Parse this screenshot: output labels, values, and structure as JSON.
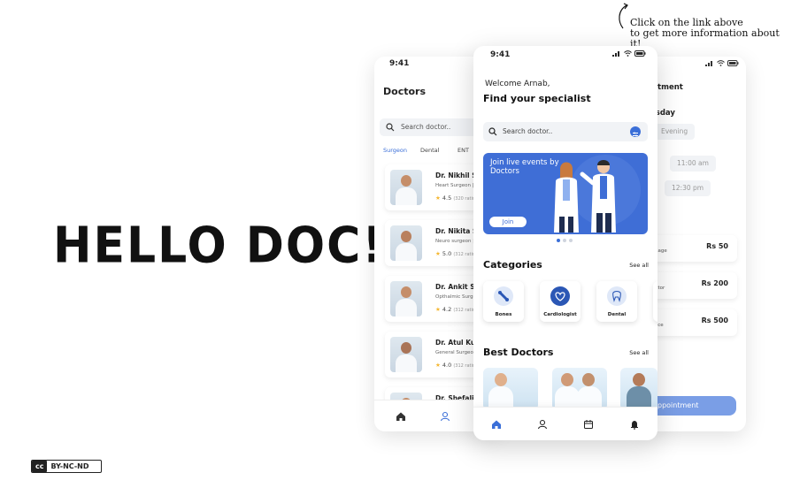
{
  "poster": {
    "title": "HELLO DOC!",
    "note_line1": "Click on the link above",
    "note_line2": "to get more information about it!",
    "license": "BY-NC-ND",
    "cc": "cc"
  },
  "phone_left": {
    "time": "9:41",
    "title": "Doctors",
    "search_placeholder": "Search doctor..",
    "tabs": [
      "Surgeon",
      "Dental",
      "ENT"
    ],
    "doctors": [
      {
        "name": "Dr. Nikhil Sh",
        "spec": "Heart Surgeon | N",
        "rating": "4.5",
        "count": "(320 ratin"
      },
      {
        "name": "Dr. Nikita Sh",
        "spec": "Neuro surgeon | ",
        "rating": "5.0",
        "count": "(312 ratin"
      },
      {
        "name": "Dr. Ankit Sin",
        "spec": "Opthalmic Surge",
        "rating": "4.2",
        "count": "(312 ratin"
      },
      {
        "name": "Dr. Atul Kull",
        "spec": "General Surgeon",
        "rating": "4.0",
        "count": "(312 ratin"
      },
      {
        "name": "Dr. Shefali S",
        "spec": "",
        "rating": "",
        "count": ""
      }
    ]
  },
  "phone_center": {
    "time": "9:41",
    "welcome": "Welcome Arnab,",
    "heading": "Find your specialist",
    "search_placeholder": "Search doctor..",
    "banner_text": "Join live events by Doctors",
    "join_label": "Join",
    "categories_title": "Categories",
    "see_all": "See all",
    "categories": [
      "Bones",
      "Cardiologist",
      "Dental"
    ],
    "best_title": "Best Doctors"
  },
  "phone_right": {
    "title": "ntment",
    "day": "esday",
    "slot_evening": "Evening",
    "slot_1100": "11:00 am",
    "slot_1230": "12:30 pm",
    "options": [
      {
        "label": "r message",
        "price": "Rs 50"
      },
      {
        "label": "he doctor",
        "price": "Rs 200"
      },
      {
        "label": "e-to-face",
        "price": "Rs 500"
      }
    ],
    "button": "ppointment"
  },
  "colors": {
    "accent": "#3b6fd8",
    "banner": "#3f6ed6",
    "star": "#f5b731"
  }
}
